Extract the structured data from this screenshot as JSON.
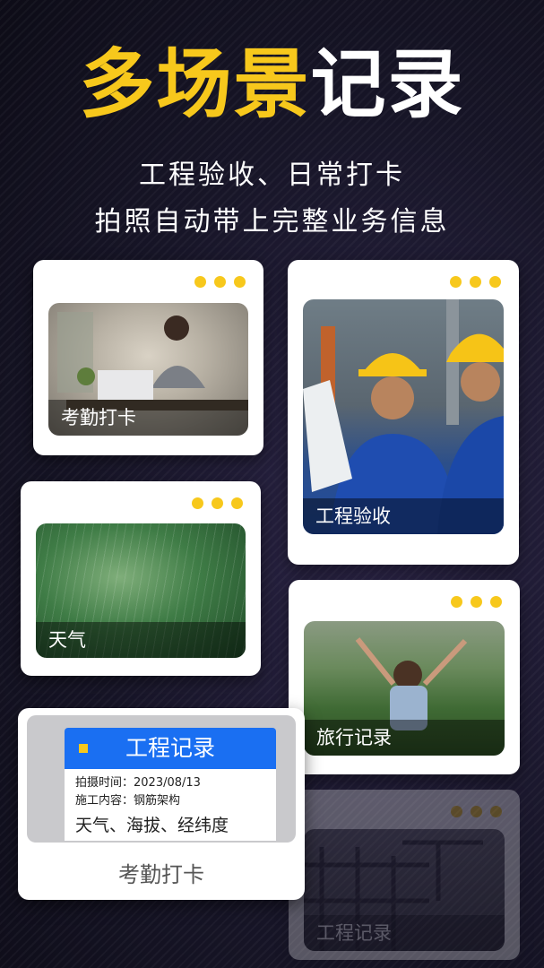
{
  "headline": {
    "part_yellow": "多场景",
    "part_white": "记录"
  },
  "subtitle": {
    "line1": "工程验收、日常打卡",
    "line2": "拍照自动带上完整业务信息"
  },
  "cards": [
    {
      "caption": "考勤打卡"
    },
    {
      "caption": "工程验收"
    },
    {
      "caption": "天气"
    },
    {
      "caption": "旅行记录"
    },
    {
      "caption": "工程记录"
    }
  ],
  "stamp": {
    "title": "工程记录",
    "time_label": "拍摄时间：2023/08/13",
    "content_label": "施工内容：钢筋架构",
    "extras": "天气、海拔、经纬度",
    "footer": "考勤打卡"
  },
  "colors": {
    "accent_yellow": "#f7c81c",
    "header_blue": "#1a6ff2"
  }
}
